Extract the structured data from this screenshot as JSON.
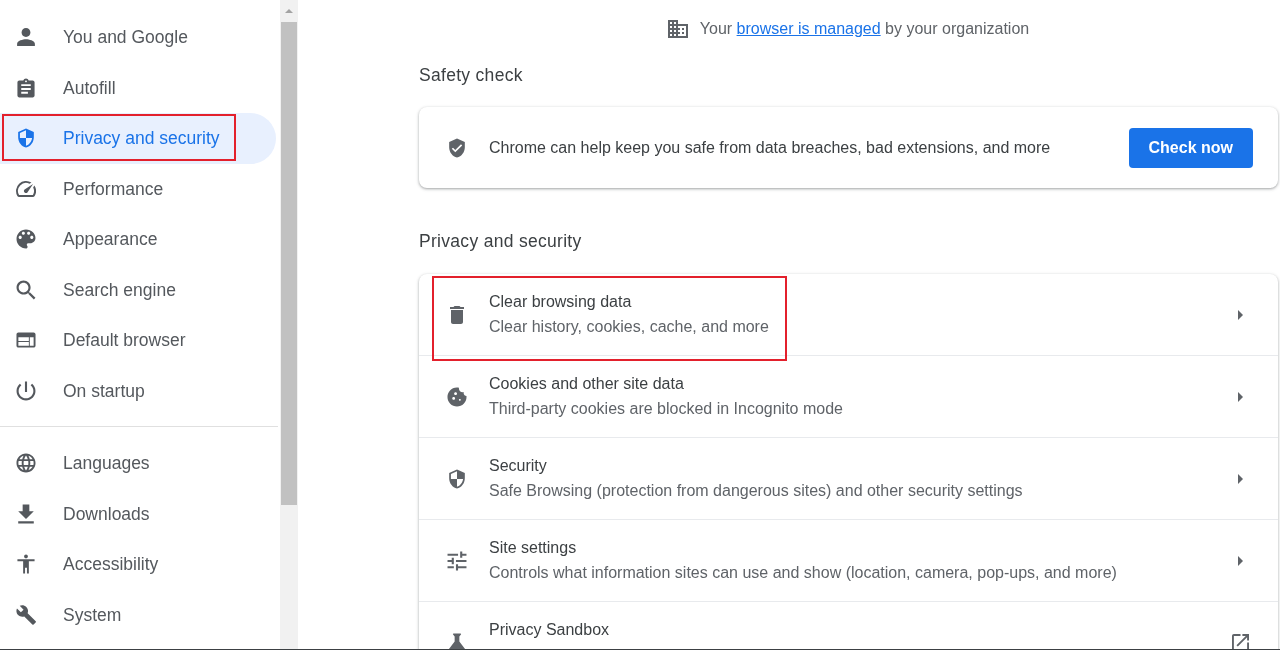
{
  "sidebar": {
    "sections": [
      {
        "items": [
          {
            "label": "You and Google",
            "selected": false,
            "highlighted": false
          },
          {
            "label": "Autofill",
            "selected": false,
            "highlighted": false
          },
          {
            "label": "Privacy and security",
            "selected": true,
            "highlighted": true
          },
          {
            "label": "Performance",
            "selected": false,
            "highlighted": false
          },
          {
            "label": "Appearance",
            "selected": false,
            "highlighted": false
          },
          {
            "label": "Search engine",
            "selected": false,
            "highlighted": false
          },
          {
            "label": "Default browser",
            "selected": false,
            "highlighted": false
          },
          {
            "label": "On startup",
            "selected": false,
            "highlighted": false
          }
        ]
      },
      {
        "items": [
          {
            "label": "Languages",
            "selected": false,
            "highlighted": false
          },
          {
            "label": "Downloads",
            "selected": false,
            "highlighted": false
          },
          {
            "label": "Accessibility",
            "selected": false,
            "highlighted": false
          },
          {
            "label": "System",
            "selected": false,
            "highlighted": false
          }
        ]
      }
    ]
  },
  "managed_notice": {
    "before": "Your",
    "link": "browser is managed",
    "after": "by your organization"
  },
  "safety_check": {
    "heading": "Safety check",
    "text": "Chrome can help keep you safe from data breaches, bad extensions, and more",
    "button": "Check now"
  },
  "privacy_and_security": {
    "heading": "Privacy and security",
    "rows": [
      {
        "kind": "submenu",
        "title": "Clear browsing data",
        "subtitle": "Clear history, cookies, cache, and more",
        "highlighted": true
      },
      {
        "kind": "submenu",
        "title": "Cookies and other site data",
        "subtitle": "Third-party cookies are blocked in Incognito mode",
        "highlighted": false
      },
      {
        "kind": "submenu",
        "title": "Security",
        "subtitle": "Safe Browsing (protection from dangerous sites) and other security settings",
        "highlighted": false
      },
      {
        "kind": "submenu",
        "title": "Site settings",
        "subtitle": "Controls what information sites can use and show (location, camera, pop-ups, and more)",
        "highlighted": false
      },
      {
        "kind": "external",
        "title": "Privacy Sandbox",
        "highlighted": false
      }
    ]
  }
}
